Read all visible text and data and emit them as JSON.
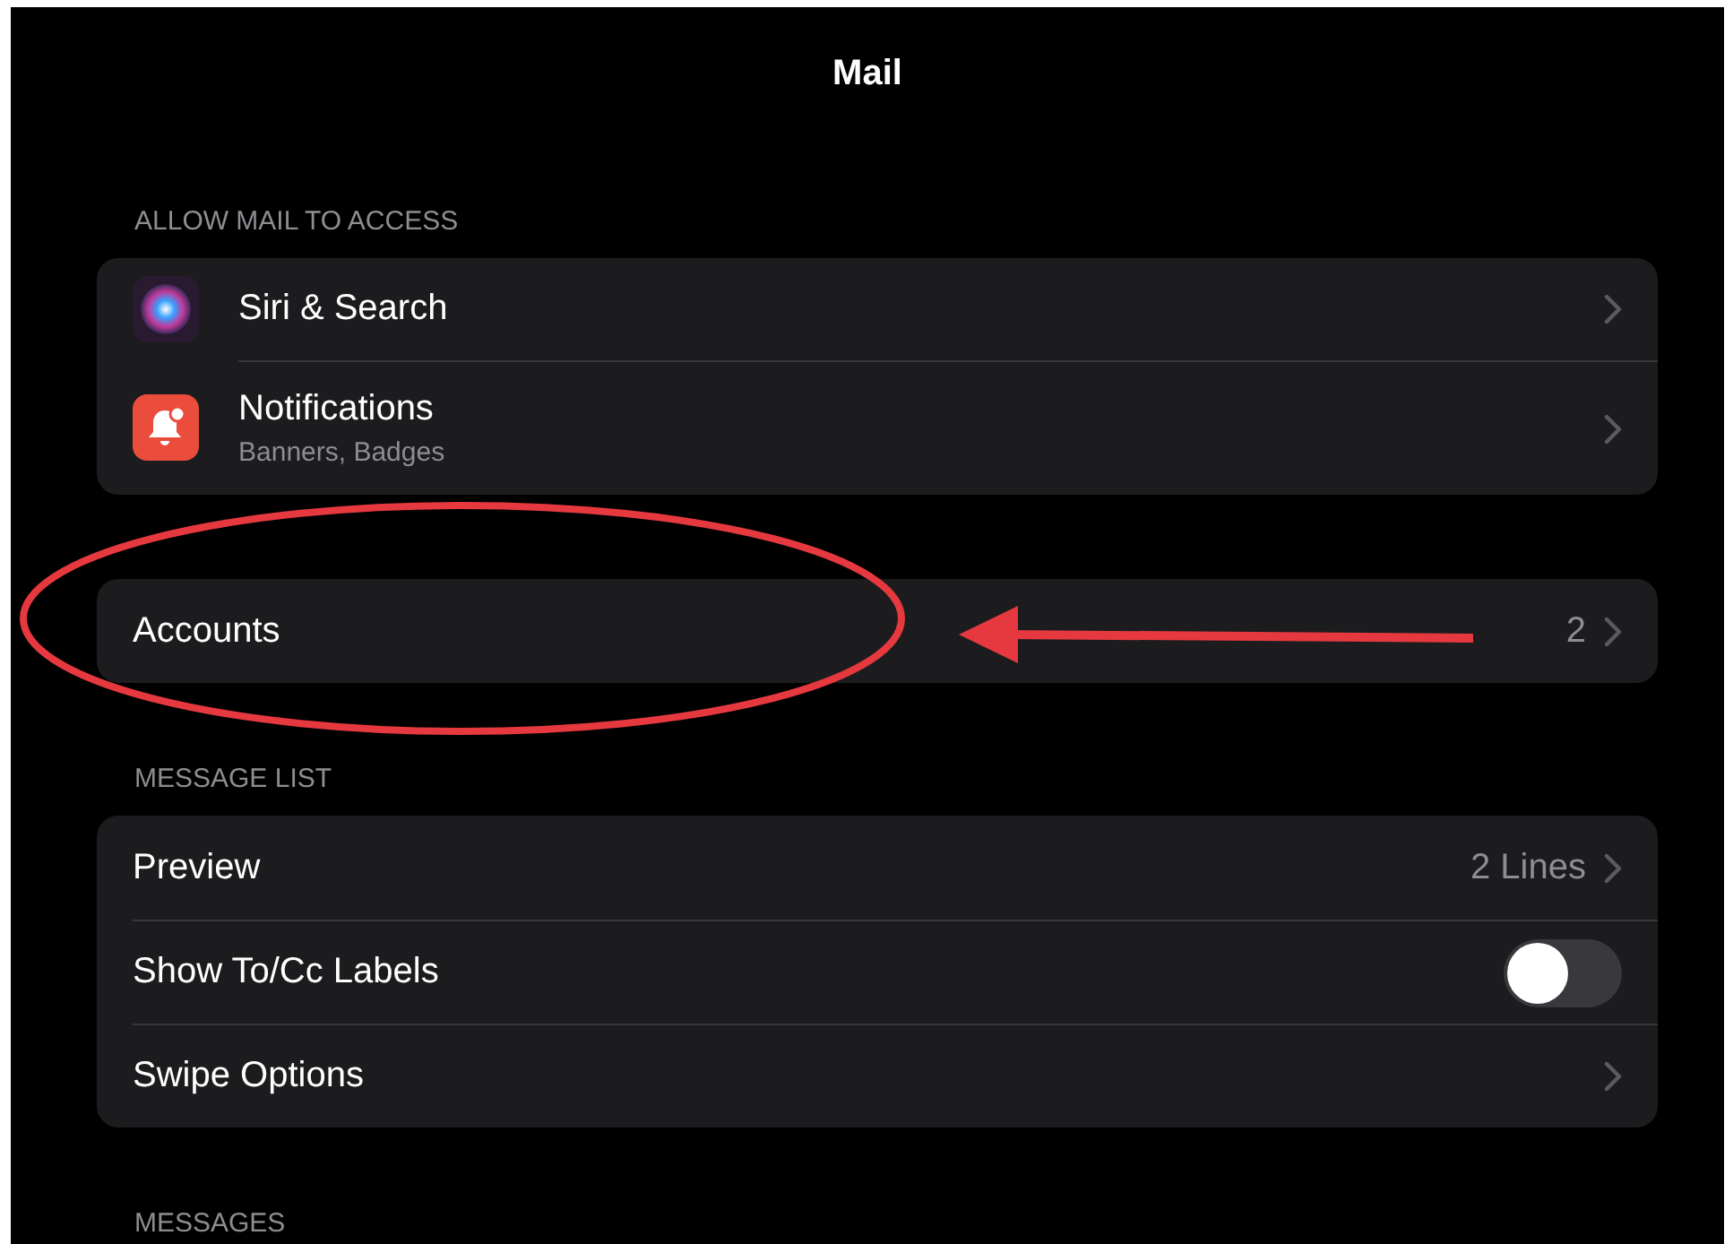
{
  "window": {
    "title": "Mail"
  },
  "sections": [
    {
      "header": "ALLOW MAIL TO ACCESS",
      "rows": [
        {
          "kind": "link",
          "label": "Siri & Search"
        },
        {
          "kind": "link",
          "label": "Notifications",
          "subtitle": "Banners, Badges"
        }
      ]
    },
    {
      "rows": [
        {
          "kind": "link",
          "label": "Accounts",
          "value": "2"
        }
      ]
    },
    {
      "header": "MESSAGE LIST",
      "rows": [
        {
          "kind": "link",
          "label": "Preview",
          "value": "2 Lines"
        },
        {
          "kind": "toggle",
          "label": "Show To/Cc Labels",
          "on": false
        },
        {
          "kind": "link",
          "label": "Swipe Options"
        }
      ]
    },
    {
      "header": "MESSAGES"
    }
  ]
}
